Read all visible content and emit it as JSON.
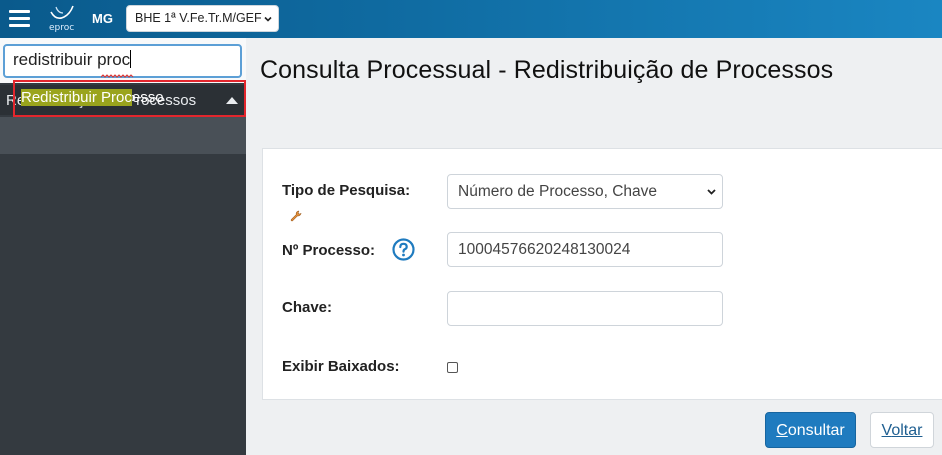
{
  "topbar": {
    "logo_text": "eproc",
    "state": "MG",
    "unit_selected": "BHE 1ª V.Fe.Tr.M/GEF"
  },
  "sidebar": {
    "search_value": "redistribuir proc",
    "group_label": "Redistribuição de Processos",
    "item": {
      "highlight_text": "Redistribuir Proc",
      "rest_text": "esso"
    }
  },
  "main": {
    "title": "Consulta Processual - Redistribuição de Processos",
    "form": {
      "tipo_label": "Tipo de Pesquisa:",
      "tipo_value": "Número de Processo, Chave",
      "processo_label": "Nº Processo:",
      "processo_value": "10004576620248130024",
      "chave_label": "Chave:",
      "chave_value": "",
      "baixados_label": "Exibir Baixados:"
    },
    "buttons": {
      "consultar_first": "C",
      "consultar_rest": "onsultar",
      "voltar_first": "V",
      "voltar_rest": "oltar"
    }
  },
  "colors": {
    "topbar": "#0f6aa0",
    "sidebar": "#343a40",
    "highlight": "#9aa41d",
    "outline": "#e3262d",
    "primary": "#1f7bbf"
  },
  "icons": [
    "menu-icon",
    "eproc-logo",
    "chevron-down-icon",
    "chevron-up-icon",
    "wrench-icon",
    "help-icon"
  ]
}
